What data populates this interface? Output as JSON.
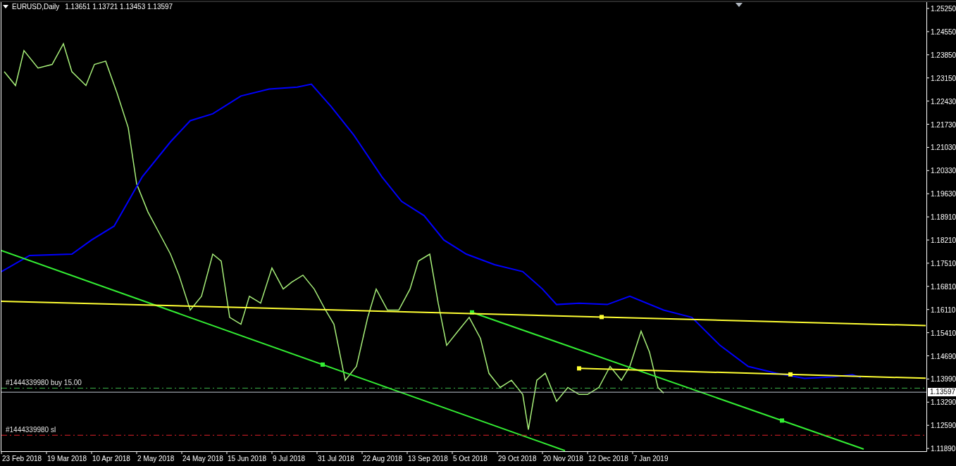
{
  "header": {
    "symbol": "EURUSD,Daily",
    "ohlc": "1.13651 1.13721 1.13453 1.13597"
  },
  "y_axis": [
    "1.25250",
    "1.24550",
    "1.23850",
    "1.23150",
    "1.22430",
    "1.21730",
    "1.21030",
    "1.20330",
    "1.19630",
    "1.18910",
    "1.18210",
    "1.17510",
    "1.16810",
    "1.16110",
    "1.15410",
    "1.14690",
    "1.13990",
    "1.13290",
    "1.12590",
    "1.11890"
  ],
  "x_axis": [
    "23 Feb 2018",
    "19 Mar 2018",
    "10 Apr 2018",
    "2 May 2018",
    "24 May 2018",
    "15 Jun 2018",
    "9 Jul 2018",
    "31 Jul 2018",
    "22 Aug 2018",
    "13 Sep 2018",
    "5 Oct 2018",
    "29 Oct 2018",
    "20 Nov 2018",
    "12 Dec 2018",
    "7 Jan 2019"
  ],
  "orders": [
    {
      "kind": "buy",
      "label": "#1444339980 buy 15.00"
    },
    {
      "kind": "sl",
      "label": "#1444339980 sl"
    }
  ],
  "current_price": "1.13597"
}
